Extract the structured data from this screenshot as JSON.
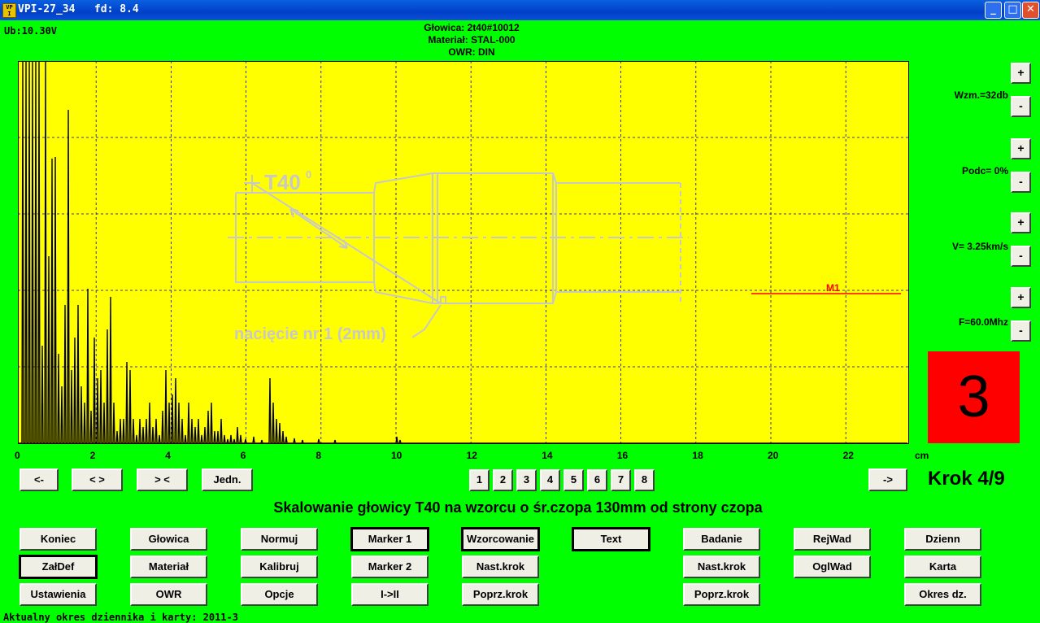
{
  "window": {
    "icon_text": "VP\nI",
    "title": "VPI-27_34   fd: 8.4"
  },
  "status_voltage": "Ub:10.30V",
  "probe_info": {
    "glowica": "Głowica: 2t40#10012",
    "material": "Materiał: STAL-000",
    "owr": "OWR: DIN"
  },
  "plot": {
    "x_ticks": [
      "0",
      "2",
      "4",
      "6",
      "8",
      "10",
      "12",
      "14",
      "16",
      "18",
      "20",
      "22"
    ],
    "unit": "cm",
    "drawing": {
      "title": "T40",
      "degree": "0",
      "notch_label": "nacięcie nr 1 (2mm)"
    },
    "marker_label": "M1",
    "colors": {
      "background": "#ffff00",
      "grid": "#0000c0",
      "trace": "#000000",
      "drawing": "#c8c8c8",
      "marker": "#ff0000"
    }
  },
  "right_panel": {
    "gain": "Wzm.=32db",
    "suppression": "Podc= 0%",
    "velocity": "V= 3.25km/s",
    "frequency": "F=60.0Mhz",
    "plus": "+",
    "minus": "-",
    "step_big": "3",
    "step_text": "Krok 4/9"
  },
  "nav": {
    "left": "<-",
    "zoom_in": "< >",
    "zoom_out": "> <",
    "units": "Jedn.",
    "right": "->",
    "pages": [
      "1",
      "2",
      "3",
      "4",
      "5",
      "6",
      "7",
      "8"
    ]
  },
  "headline": "Skalowanie głowicy T40 na wzorcu o śr.czopa 130mm od strony czopa",
  "buttons": {
    "koniec": "Koniec",
    "zaldef": "ZałDef",
    "ustawienia": "Ustawienia",
    "glowica": "Głowica",
    "material": "Materiał",
    "owr": "OWR",
    "normuj": "Normuj",
    "kalibruj": "Kalibruj",
    "opcje": "Opcje",
    "marker1": "Marker 1",
    "marker2": "Marker 2",
    "i_ii": "I->II",
    "wzorcowanie": "Wzorcowanie",
    "nast_krok_1": "Nast.krok",
    "poprz_krok_1": "Poprz.krok",
    "text": "Text",
    "badanie": "Badanie",
    "nast_krok_2": "Nast.krok",
    "poprz_krok_2": "Poprz.krok",
    "rejwad": "RejWad",
    "oglwad": "OglWad",
    "dziennik": "Dzienn",
    "karta": "Karta",
    "okres": "Okres dz."
  },
  "status_bar": "Aktualny okres dziennika i karty: 2011-3"
}
